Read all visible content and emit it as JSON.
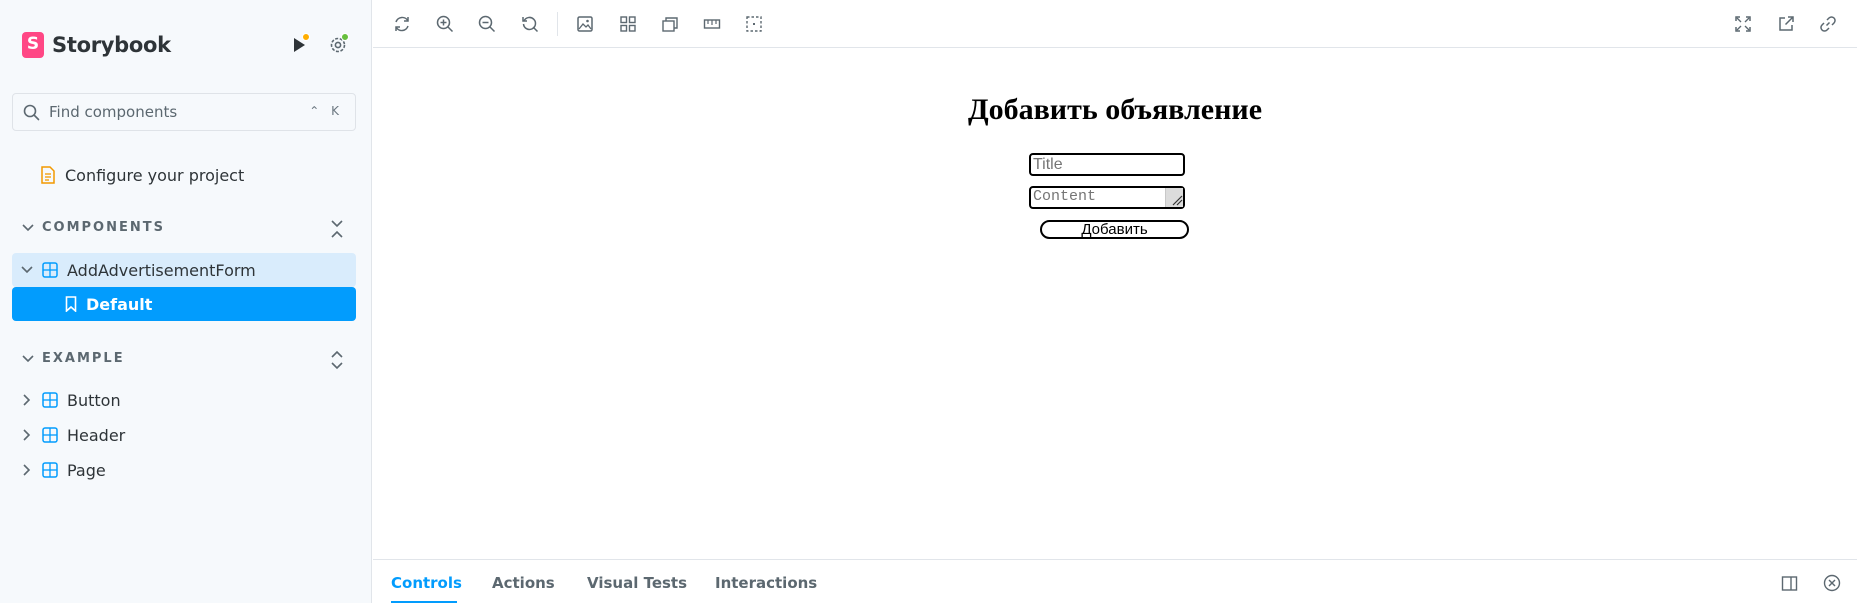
{
  "app": {
    "name": "Storybook",
    "logo_letter": "S"
  },
  "colors": {
    "accent": "#029cfd",
    "brand": "#ff4785",
    "notify_orange": "#ffae00",
    "status_green": "#66bf3c"
  },
  "sidebar": {
    "search_placeholder": "Find components",
    "search_shortcut": "⌃ K",
    "configure_item": "Configure your project",
    "sections": [
      {
        "title": "COMPONENTS",
        "items": [
          {
            "label": "AddAdvertisementForm",
            "expanded": true,
            "stories": [
              {
                "label": "Default",
                "selected": true
              }
            ]
          }
        ]
      },
      {
        "title": "EXAMPLE",
        "items": [
          {
            "label": "Button"
          },
          {
            "label": "Header"
          },
          {
            "label": "Page"
          }
        ]
      }
    ]
  },
  "toolbar": {
    "left_icons": [
      "reload-icon",
      "zoom-in-icon",
      "zoom-out-icon",
      "zoom-reset-icon",
      "background-icon",
      "grid-icon",
      "viewport-icon",
      "measure-icon",
      "outline-icon"
    ],
    "right_icons": [
      "fullscreen-icon",
      "open-new-tab-icon",
      "copy-link-icon"
    ]
  },
  "canvas": {
    "heading": "Добавить объявление",
    "title_placeholder": "Title",
    "content_placeholder": "Content",
    "submit_label": "Добавить"
  },
  "panel": {
    "tabs": [
      "Controls",
      "Actions",
      "Visual Tests",
      "Interactions"
    ],
    "active_tab": "Controls"
  }
}
